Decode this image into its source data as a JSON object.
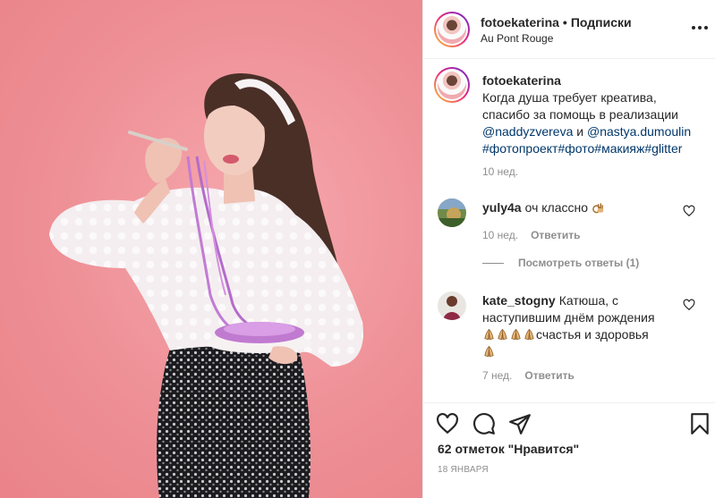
{
  "post": {
    "username": "fotoekaterina",
    "separator": "•",
    "follow_label": "Подписки",
    "location": "Au Pont Rouge"
  },
  "caption": {
    "username": "fotoekaterina",
    "line1": "Когда душа требует креатива,",
    "line2": "спасибо за помощь в реализации",
    "mention1": "@naddyzvereva",
    "and": " и ",
    "mention2": "@nastya.dumoulin",
    "hashtags": "#фотопроект#фото#макияж#glitter",
    "time": "10 нед."
  },
  "comments": [
    {
      "username": "yuly4a",
      "text": "оч классно",
      "emoji": "ok-hand",
      "time": "10 нед.",
      "reply_label": "Ответить",
      "view_replies": "Посмотреть ответы (1)"
    },
    {
      "username": "kate_stogny",
      "text_line1": "Катюша, с",
      "text_line2": "наступившим днём рождения",
      "emoji": "praying-hands",
      "emoji_count": 4,
      "text_line3_end": "счастья и здоровья",
      "time": "7 нед.",
      "reply_label": "Ответить"
    }
  ],
  "footer": {
    "likes": "62 отметок \"Нравится\"",
    "date": "18 ЯНВАРЯ"
  },
  "icons": {
    "more": "more-options-icon",
    "like": "heart-icon",
    "comment": "comment-icon",
    "share": "share-icon",
    "save": "bookmark-icon"
  },
  "colors": {
    "link": "#00376b",
    "muted": "#8e8e8e",
    "text": "#262626",
    "photo_background": "#ee9096"
  }
}
